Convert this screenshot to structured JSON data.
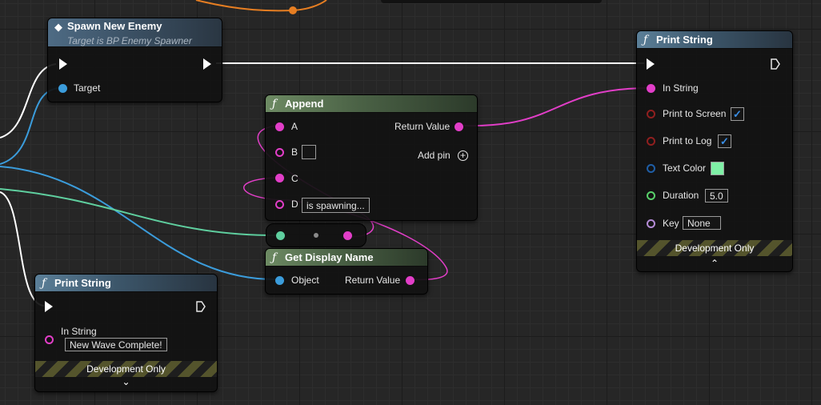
{
  "colors": {
    "exec": "#ffffff",
    "object": "#3b9cdb",
    "string": "#e23ec8",
    "boolean": "#8f1f1f",
    "struct": "#1f5ea6",
    "float": "#58d16a",
    "name": "#b48bd6",
    "linear_color_wire": "#5fcf9f",
    "orange_wire": "#e67e22",
    "text_color_swatch": "#7ff0a6"
  },
  "spawn_node": {
    "title": "Spawn New Enemy",
    "subtitle": "Target is BP Enemy Spawner",
    "icon": "event-icon",
    "target_label": "Target"
  },
  "print_right": {
    "title": "Print String",
    "icon": "function-icon",
    "in_string_label": "In String",
    "print_to_screen_label": "Print to Screen",
    "print_to_log_label": "Print to Log",
    "text_color_label": "Text Color",
    "duration_label": "Duration",
    "duration_value": "5.0",
    "key_label": "Key",
    "key_value": "None",
    "print_to_screen_checked": "✓",
    "print_to_log_checked": "✓",
    "dev_only": "Development Only",
    "chevron": "⌃"
  },
  "append_node": {
    "title": "Append",
    "icon": "function-icon",
    "a_label": "A",
    "b_label": "B",
    "c_label": "C",
    "d_label": "D",
    "d_value": "is spawning...",
    "return_label": "Return Value",
    "add_pin_label": "Add pin",
    "add_pin_icon": "+"
  },
  "display_name_node": {
    "title": "Get Display Name",
    "icon": "function-icon",
    "object_label": "Object",
    "return_label": "Return Value"
  },
  "print_left": {
    "title": "Print String",
    "icon": "function-icon",
    "in_string_label": "In String",
    "in_string_value": "New Wave Complete!",
    "dev_only": "Development Only",
    "chevron": "⌄"
  }
}
